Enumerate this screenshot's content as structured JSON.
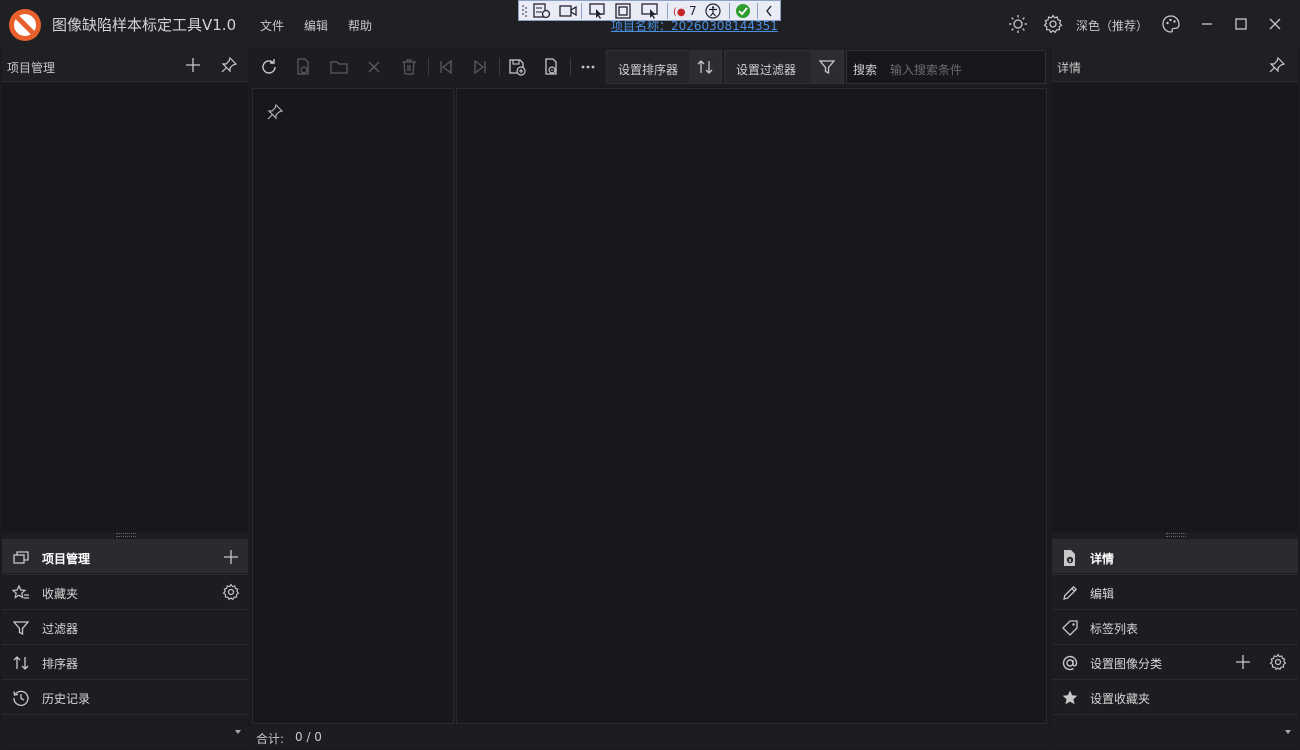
{
  "app": {
    "title": "图像缺陷样本标定工具V1.0",
    "project_name": "项目名称：20260308144351",
    "theme_label": "深色（推荐）"
  },
  "menu": [
    "文件",
    "编辑",
    "帮助"
  ],
  "debug_toolbar": {
    "count": "7"
  },
  "left_panel": {
    "header_title": "项目管理",
    "nav": [
      {
        "label": "项目管理",
        "icon": "project-icon",
        "active": true
      },
      {
        "label": "收藏夹",
        "icon": "star-list-icon"
      },
      {
        "label": "过滤器",
        "icon": "filter-icon"
      },
      {
        "label": "排序器",
        "icon": "sort-icon"
      },
      {
        "label": "历史记录",
        "icon": "history-icon"
      }
    ]
  },
  "center": {
    "sorter_label": "设置排序器",
    "filter_label": "设置过滤器",
    "search_label": "搜索",
    "search_placeholder": "输入搜索条件",
    "footer_label": "合计:",
    "footer_count": "0 / 0"
  },
  "right_panel": {
    "header_title": "详情",
    "nav": [
      {
        "label": "详情",
        "icon": "file-info-icon",
        "active": true
      },
      {
        "label": "编辑",
        "icon": "pencil-icon"
      },
      {
        "label": "标签列表",
        "icon": "tag-icon"
      },
      {
        "label": "设置图像分类",
        "icon": "at-icon"
      },
      {
        "label": "设置收藏夹",
        "icon": "star-icon"
      }
    ]
  },
  "colors": {
    "background": "#1a1b1f",
    "panel": "#17181c",
    "accent_link": "#4a90e2",
    "logo": "#e8612c"
  }
}
